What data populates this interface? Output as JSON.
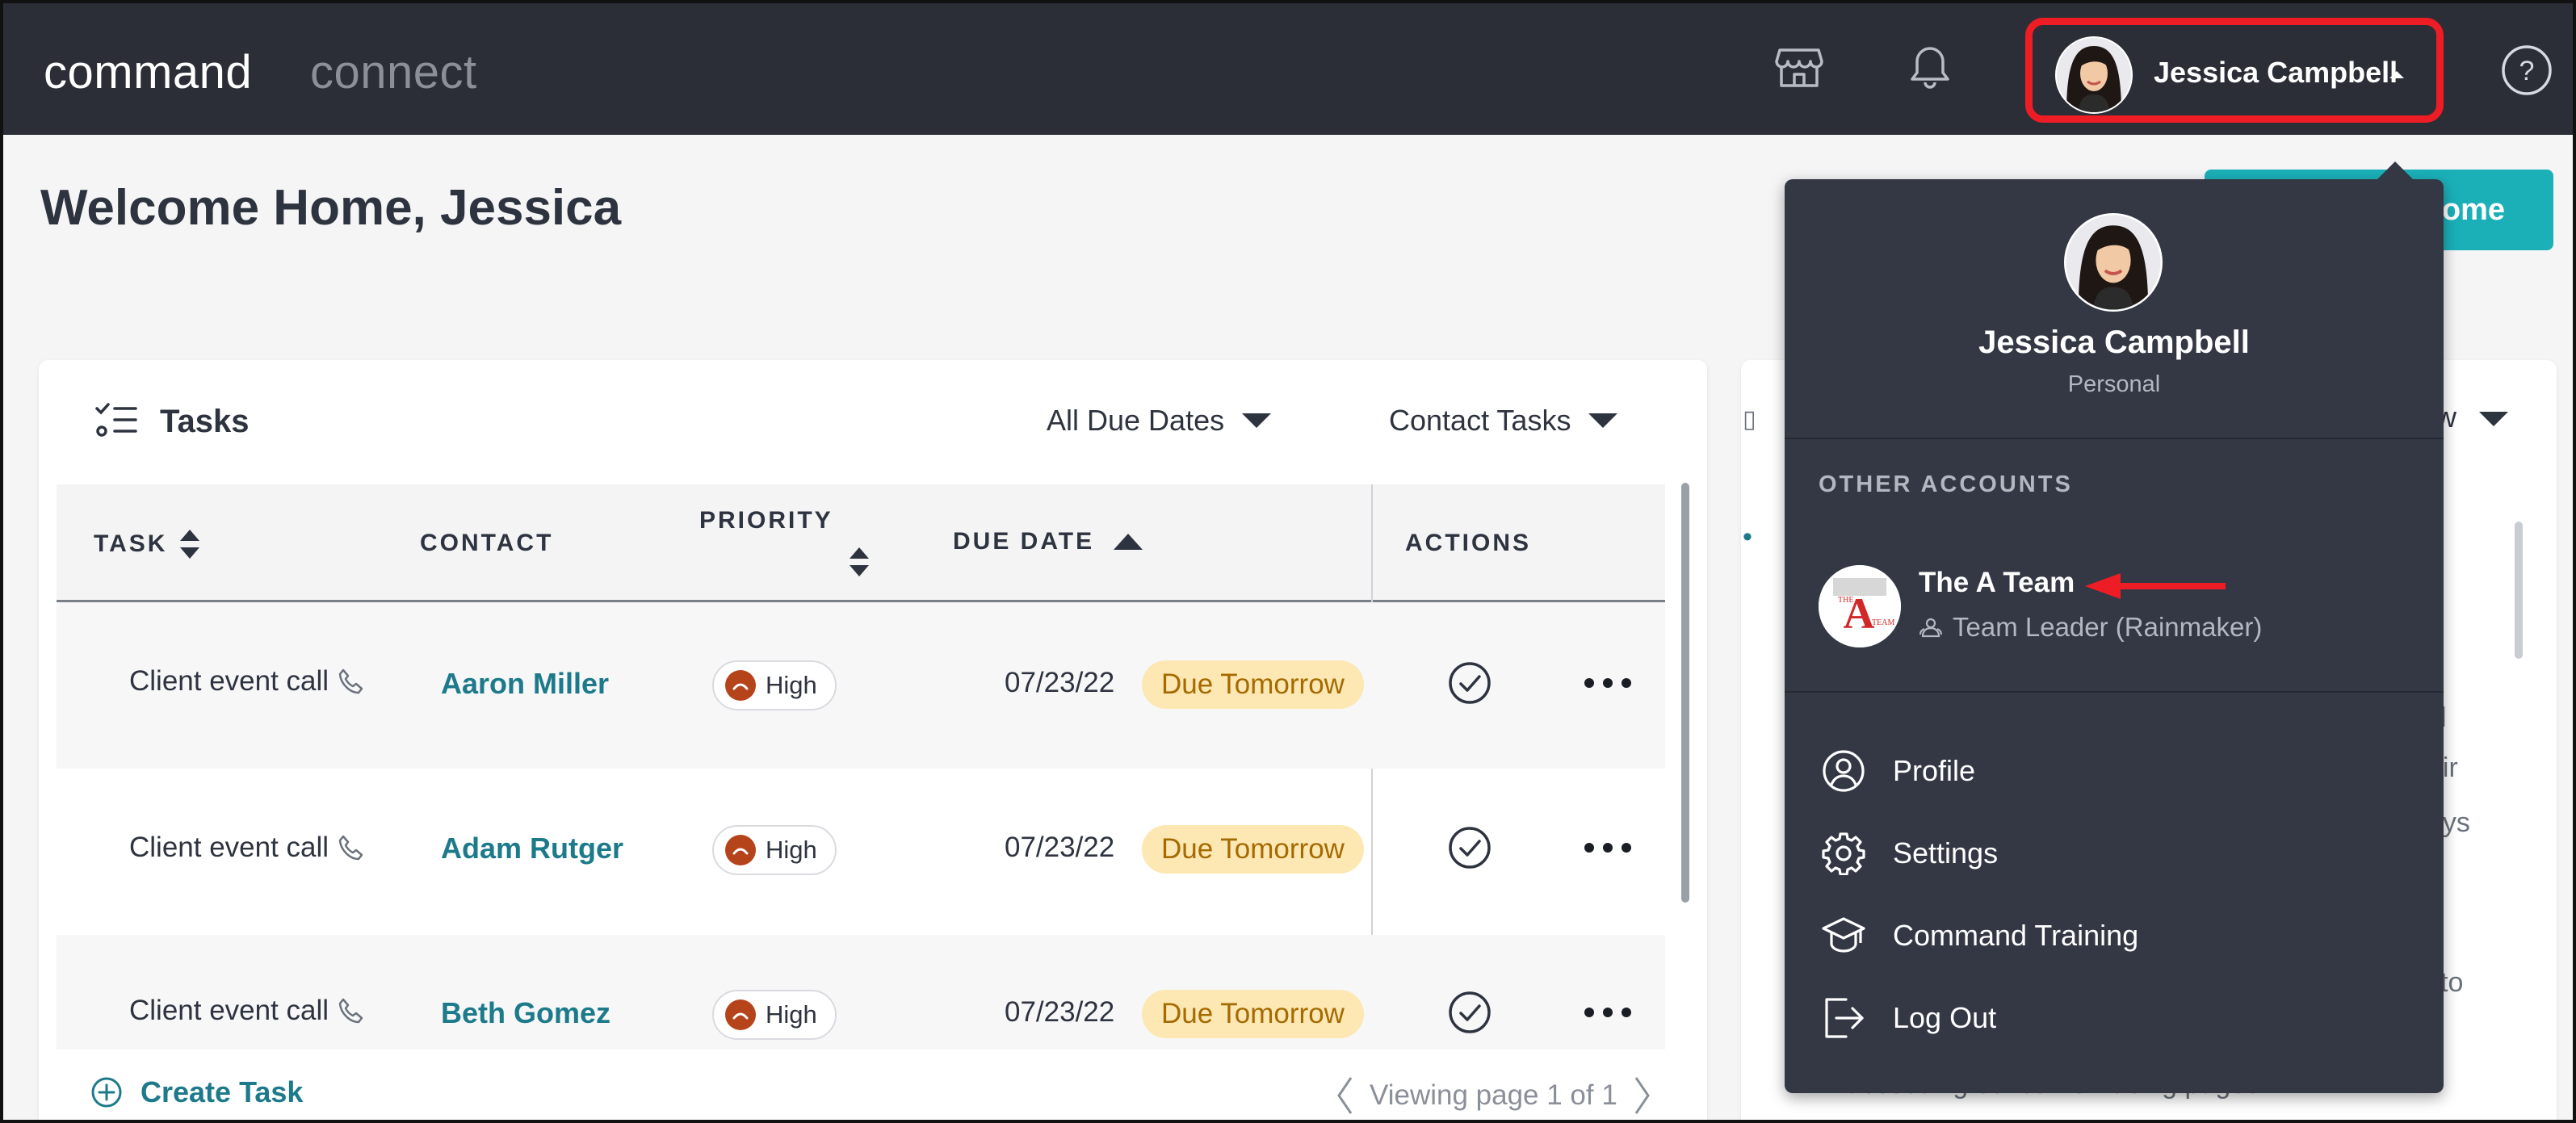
{
  "topnav": {
    "brand_command": "command",
    "brand_connect": "connect",
    "icons": [
      "storefront-icon",
      "bell-icon",
      "help-icon"
    ],
    "user_name": "Jessica Campbell",
    "highlight_color": "#ee1c25"
  },
  "page": {
    "welcome": "Welcome Home, Jessica",
    "home_button_label": "Home"
  },
  "tasks": {
    "title": "Tasks",
    "filter_due": "All Due Dates",
    "filter_contact": "Contact Tasks",
    "columns": {
      "task": "TASK",
      "contact": "CONTACT",
      "priority": "PRIORITY",
      "due_date": "DUE DATE",
      "actions": "ACTIONS"
    },
    "rows": [
      {
        "task": "Client event call",
        "contact": "Aaron Miller",
        "priority": "High",
        "due": "07/23/22",
        "badge": "Due Tomorrow"
      },
      {
        "task": "Client event call",
        "contact": "Adam Rutger",
        "priority": "High",
        "due": "07/23/22",
        "badge": "Due Tomorrow"
      },
      {
        "task": "Client event call",
        "contact": "Beth Gomez",
        "priority": "High",
        "due": "07/23/22",
        "badge": "Due Tomorrow"
      }
    ],
    "create_task": "Create Task",
    "pager": "Viewing page 1 of 1"
  },
  "right_card": {
    "peek_header": "w",
    "peek_lines": [
      "l",
      "eir",
      "ays",
      "to",
      "accessing consumer facing pages."
    ]
  },
  "dropdown": {
    "name": "Jessica Campbell",
    "subtitle": "Personal",
    "section_label": "OTHER ACCOUNTS",
    "account_name": "The A Team",
    "account_role": "Team Leader (Rainmaker)",
    "menu": [
      {
        "label": "Profile",
        "icon": "user-circle-icon"
      },
      {
        "label": "Settings",
        "icon": "gear-icon"
      },
      {
        "label": "Command Training",
        "icon": "graduation-cap-icon"
      },
      {
        "label": "Log Out",
        "icon": "logout-icon"
      }
    ]
  }
}
